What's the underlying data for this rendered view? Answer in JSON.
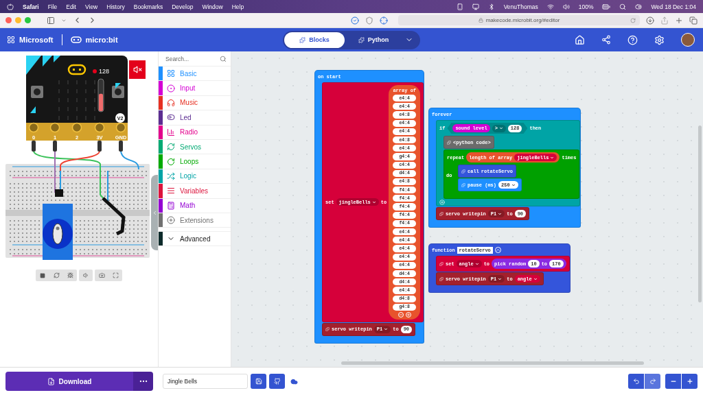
{
  "menubar": {
    "app": "Safari",
    "menus": [
      "File",
      "Edit",
      "View",
      "History",
      "Bookmarks",
      "Develop",
      "Window",
      "Help"
    ],
    "user": "VenuThomas",
    "battery": "100%",
    "clock": "Wed 18 Dec 1:04"
  },
  "browser": {
    "url": "makecode.microbit.org/#editor"
  },
  "header": {
    "brand": "Microsoft",
    "product": "micro:bit",
    "modes": [
      {
        "label": "Blocks",
        "selected": true
      },
      {
        "label": "Python",
        "selected": false
      }
    ]
  },
  "simulator": {
    "sound_reading": "128",
    "level": 0.55,
    "version": "V2",
    "pins": [
      "0",
      "1",
      "2",
      "3V",
      "GND"
    ],
    "muted": true
  },
  "toolbox": {
    "search_placeholder": "Search...",
    "categories": [
      {
        "label": "Basic",
        "color": "#1e90ff"
      },
      {
        "label": "Input",
        "color": "#d400d4"
      },
      {
        "label": "Music",
        "color": "#e63022"
      },
      {
        "label": "Led",
        "color": "#5c2d91"
      },
      {
        "label": "Radio",
        "color": "#e3008c"
      },
      {
        "label": "Servos",
        "color": "#03aa74"
      },
      {
        "label": "Loops",
        "color": "#00aa00"
      },
      {
        "label": "Logic",
        "color": "#00a4a6"
      },
      {
        "label": "Variables",
        "color": "#dc143c"
      },
      {
        "label": "Math",
        "color": "#9400d3"
      },
      {
        "label": "Extensions",
        "color": "#717171"
      }
    ],
    "advanced": "Advanced"
  },
  "workspace": {
    "stacks": [
      {
        "kind": "hat",
        "color": "#1e90ff",
        "parts": [
          {
            "kind": "label",
            "text": "on start"
          }
        ],
        "body": [
          {
            "kind": "assign",
            "color": "#d6003a",
            "parts": [
              {
                "kind": "label",
                "text": "set"
              },
              {
                "kind": "dropdown",
                "text": "jingleBells"
              },
              {
                "kind": "label",
                "text": "to"
              },
              {
                "kind": "array",
                "color": "#e8532c",
                "label": "array of",
                "items": [
                  "e4:4",
                  "e4:4",
                  "e4:8",
                  "e4:4",
                  "e4:4",
                  "e4:8",
                  "e4:4",
                  "g4:4",
                  "c4:4",
                  "d4:4",
                  "e4:8",
                  "f4:4",
                  "f4:4",
                  "f4:4",
                  "f4:4",
                  "f4:4",
                  "e4:4",
                  "e4:4",
                  "e4:4",
                  "e4:4",
                  "e4:4",
                  "d4:4",
                  "d4:4",
                  "e4:4",
                  "d4:8",
                  "g4:8"
                ]
              }
            ]
          },
          {
            "kind": "statement",
            "color": "#a3202d",
            "parts": [
              {
                "kind": "label",
                "text": "servo writepin"
              },
              {
                "kind": "dropdown",
                "text": "P1"
              },
              {
                "kind": "label",
                "text": "to"
              },
              {
                "kind": "number",
                "text": "90"
              }
            ]
          }
        ]
      },
      {
        "kind": "hat",
        "color": "#1e90ff",
        "parts": [
          {
            "kind": "label",
            "text": "forever"
          }
        ],
        "body": [
          {
            "kind": "if",
            "color": "#00a4a6",
            "parts": [
              {
                "kind": "label",
                "text": "if"
              },
              {
                "kind": "condition",
                "color": "#008b8d",
                "parts": [
                  {
                    "kind": "reporter",
                    "color": "#d400d4",
                    "parts": [
                      {
                        "kind": "label",
                        "text": "sound level"
                      }
                    ]
                  },
                  {
                    "kind": "dropdown",
                    "text": ">"
                  },
                  {
                    "kind": "number",
                    "text": "128"
                  }
                ]
              },
              {
                "kind": "label",
                "text": "then"
              }
            ],
            "body": [
              {
                "kind": "statement",
                "color": "#6b6b6b",
                "parts": [
                  {
                    "kind": "label",
                    "text": "<python code>"
                  }
                ]
              },
              {
                "kind": "loop",
                "color": "#00a000",
                "parts": [
                  {
                    "kind": "label",
                    "text": "repeat"
                  },
                  {
                    "kind": "reporter",
                    "color": "#e8532c",
                    "parts": [
                      {
                        "kind": "label",
                        "text": "length of array"
                      },
                      {
                        "kind": "variable",
                        "color": "#d6003a",
                        "text": "jingleBells"
                      }
                    ]
                  },
                  {
                    "kind": "label",
                    "text": "times"
                  }
                ],
                "rail_label": "do",
                "body": [
                  {
                    "kind": "statement",
                    "color": "#3455db",
                    "parts": [
                      {
                        "kind": "label",
                        "text": "call"
                      },
                      {
                        "kind": "label",
                        "text": "rotateServo"
                      }
                    ]
                  },
                  {
                    "kind": "statement",
                    "color": "#1e90ff",
                    "parts": [
                      {
                        "kind": "label",
                        "text": "pause (ms)"
                      },
                      {
                        "kind": "number-dropdown",
                        "text": "250"
                      }
                    ]
                  }
                ]
              }
            ]
          },
          {
            "kind": "statement",
            "color": "#a3202d",
            "parts": [
              {
                "kind": "label",
                "text": "servo writepin"
              },
              {
                "kind": "dropdown",
                "text": "P1"
              },
              {
                "kind": "label",
                "text": "to"
              },
              {
                "kind": "number",
                "text": "90"
              }
            ]
          }
        ]
      },
      {
        "kind": "function",
        "color": "#3455db",
        "parts": [
          {
            "kind": "label",
            "text": "function"
          },
          {
            "kind": "field",
            "text": "rotateServo"
          }
        ],
        "body": [
          {
            "kind": "statement",
            "color": "#d6003a",
            "parts": [
              {
                "kind": "label",
                "text": "set"
              },
              {
                "kind": "dropdown",
                "text": "angle"
              },
              {
                "kind": "label",
                "text": "to"
              },
              {
                "kind": "reporter",
                "color": "#8a2be2",
                "parts": [
                  {
                    "kind": "label",
                    "text": "pick random"
                  },
                  {
                    "kind": "number",
                    "text": "10"
                  },
                  {
                    "kind": "label",
                    "text": "to"
                  },
                  {
                    "kind": "number",
                    "text": "170"
                  }
                ]
              }
            ]
          },
          {
            "kind": "statement",
            "color": "#a3202d",
            "parts": [
              {
                "kind": "label",
                "text": "servo writepin"
              },
              {
                "kind": "dropdown",
                "text": "P1"
              },
              {
                "kind": "label",
                "text": "to"
              },
              {
                "kind": "variable",
                "color": "#d6003a",
                "text": "angle"
              }
            ]
          }
        ]
      }
    ]
  },
  "bottom": {
    "download": "Download",
    "project_name": "Jingle Bells"
  }
}
